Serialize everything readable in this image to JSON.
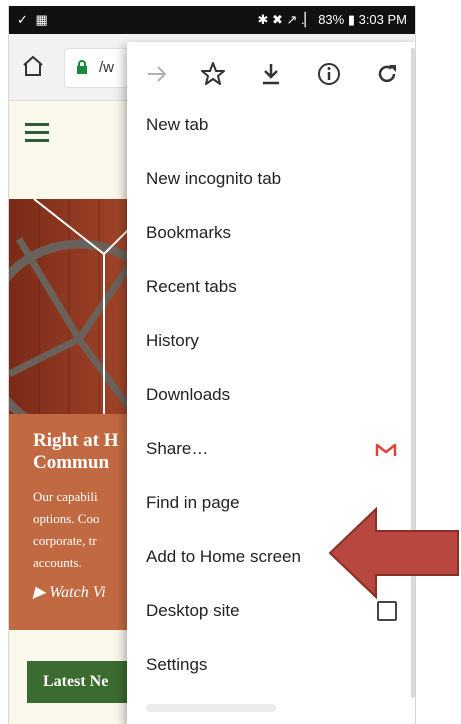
{
  "status_bar": {
    "left_icons": "✓ ▦",
    "right_text": "✱ ✖ ↗ .▏ 83% ▮ 3:03 PM"
  },
  "url_bar": {
    "url_text": "/w"
  },
  "website": {
    "promo_title": "Right at H\nCommun",
    "promo_body": "Our capabili\noptions. Coo\ncorporate, tr\naccounts.",
    "promo_video": "▶ Watch Vi",
    "latest_button": "Latest Ne"
  },
  "menu": {
    "items": [
      {
        "label": "New tab"
      },
      {
        "label": "New incognito tab"
      },
      {
        "label": "Bookmarks"
      },
      {
        "label": "Recent tabs"
      },
      {
        "label": "History"
      },
      {
        "label": "Downloads"
      },
      {
        "label": "Share…"
      },
      {
        "label": "Find in page"
      },
      {
        "label": "Add to Home screen"
      },
      {
        "label": "Desktop site"
      },
      {
        "label": "Settings"
      }
    ]
  },
  "colors": {
    "menu_bg": "#ffffff",
    "arrow_fill": "#b8473f",
    "gmail_red": "#e04438",
    "promo_bg": "#c16a42",
    "header_bg": "#fbf8ec",
    "button_green": "#3b6b2e"
  }
}
